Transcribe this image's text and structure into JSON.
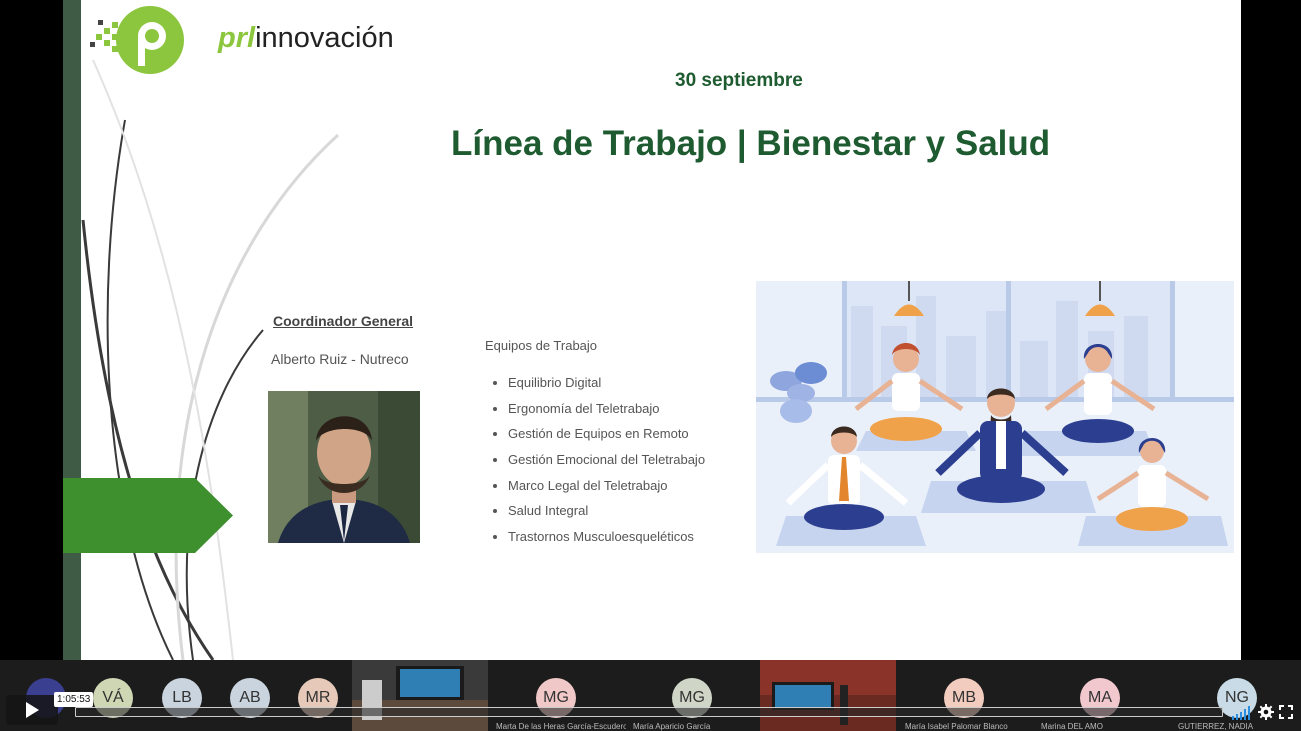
{
  "slide": {
    "logo_prefix": "prl",
    "logo_suffix": "innovación",
    "date": "30 septiembre",
    "title": "Línea de Trabajo | Bienestar y Salud",
    "coordinator_label": "Coordinador General",
    "coordinator_name": "Alberto Ruiz - Nutreco",
    "teams_label": "Equipos de Trabajo",
    "teams": [
      "Equilibrio Digital",
      "Ergonomía del Teletrabajo",
      "Gestión de Equipos en Remoto",
      "Gestión Emocional del Teletrabajo",
      "Marco Legal del Teletrabajo",
      "Salud Integral",
      "Trastornos Musculoesqueléticos"
    ],
    "colors": {
      "brand_green": "#8cc63f",
      "title_green": "#1e5b30",
      "arrow_green": "#3e8f2d"
    }
  },
  "participants": [
    {
      "initials": "VÁ",
      "name": ""
    },
    {
      "initials": "LB",
      "name": ""
    },
    {
      "initials": "AB",
      "name": ""
    },
    {
      "initials": "MR",
      "name": ""
    },
    {
      "initials": "MG",
      "name": "Marta De las Heras García-Escudero"
    },
    {
      "initials": "MG",
      "name": "María Aparicio García"
    },
    {
      "initials": "MB",
      "name": "María Isabel Palomar Blanco"
    },
    {
      "initials": "MA",
      "name": "Marina DEL AMO"
    },
    {
      "initials": "NG",
      "name": "GUTIERREZ, NADIA"
    }
  ],
  "player": {
    "time_tooltip": "1:05:53",
    "progress_fraction": 0.0,
    "icons": [
      "play-icon",
      "volume-icon",
      "gear-icon",
      "fullscreen-icon"
    ]
  }
}
